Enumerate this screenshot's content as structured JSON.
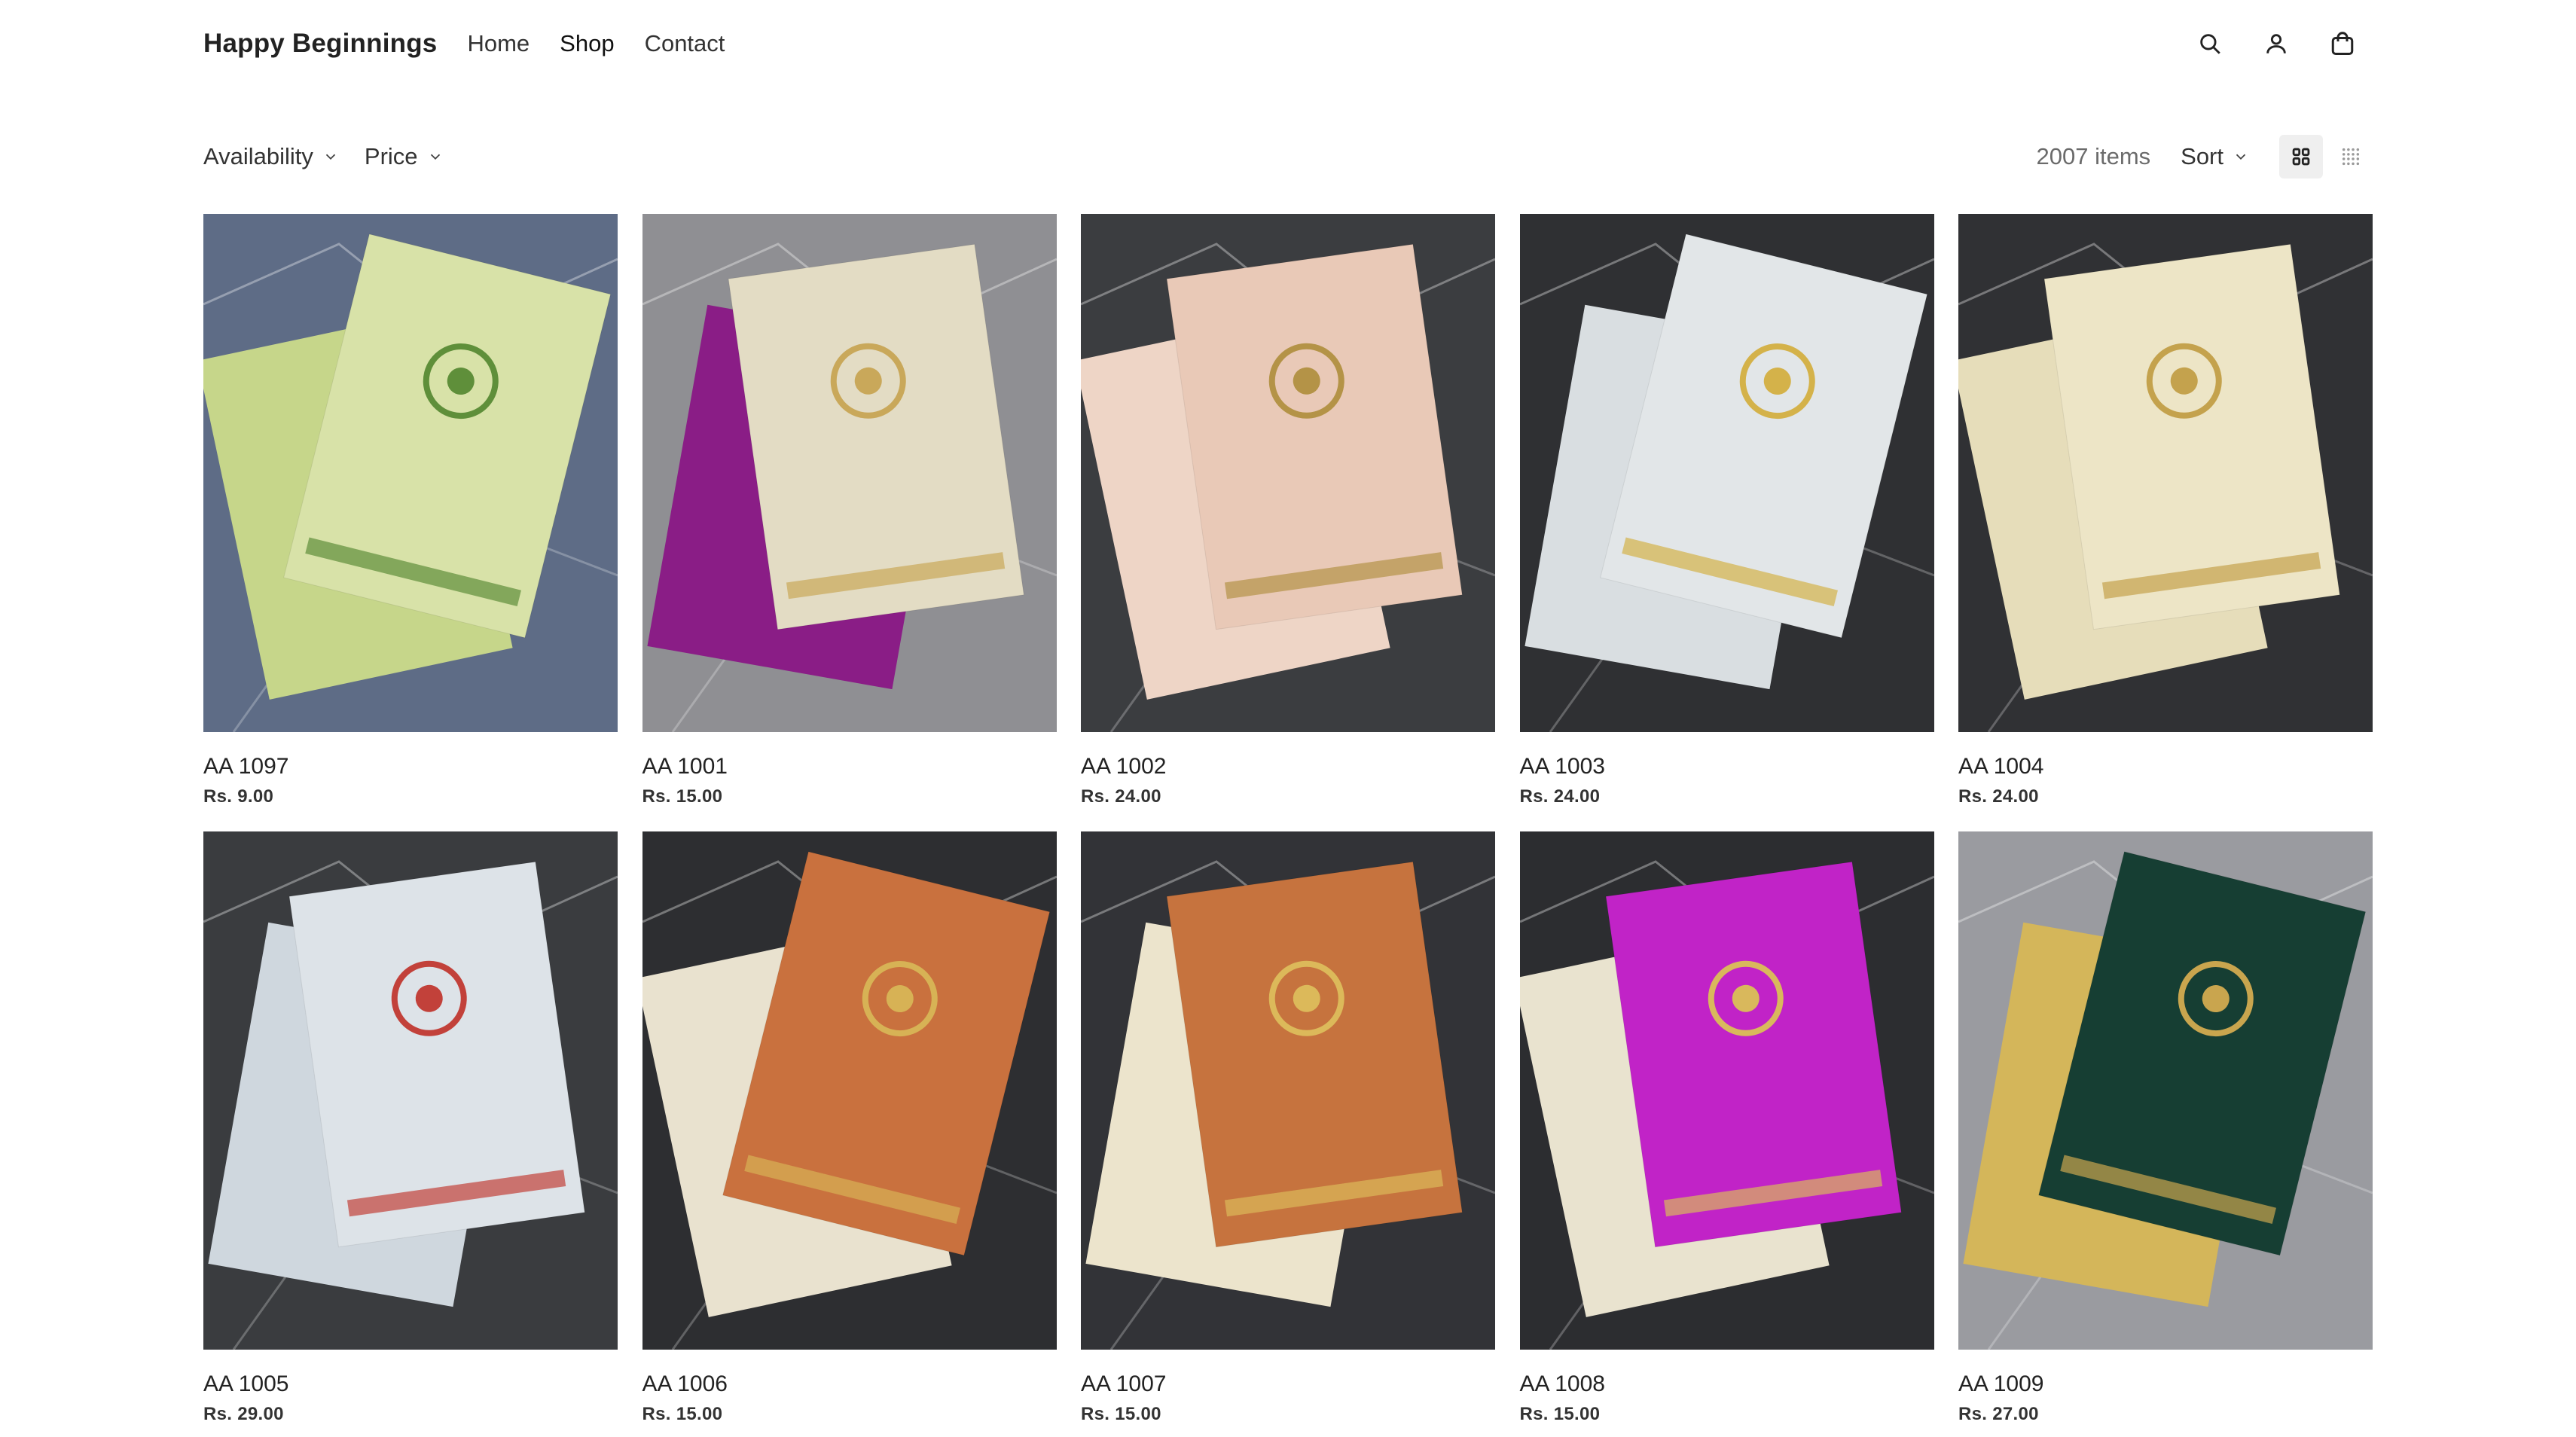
{
  "header": {
    "brand": "Happy Beginnings",
    "nav": [
      {
        "label": "Home"
      },
      {
        "label": "Shop"
      },
      {
        "label": "Contact"
      }
    ],
    "icons": [
      "search-icon",
      "account-icon",
      "cart-icon"
    ]
  },
  "filters": {
    "availability": "Availability",
    "price": "Price",
    "item_count": "2007 items",
    "sort": "Sort"
  },
  "products": [
    {
      "name": "AA 1097",
      "price": "Rs. 9.00",
      "bg": "#5e6c86",
      "card": "#d8e2a8",
      "env": "#c6d68a",
      "accent": "#5f8f3a"
    },
    {
      "name": "AA 1001",
      "price": "Rs. 15.00",
      "bg": "#8f8f93",
      "card": "#e3dcc4",
      "env": "#8a1d86",
      "accent": "#c9a85a"
    },
    {
      "name": "AA 1002",
      "price": "Rs. 24.00",
      "bg": "#3b3d40",
      "card": "#e9c9b7",
      "env": "#eed5c6",
      "accent": "#b49347"
    },
    {
      "name": "AA 1003",
      "price": "Rs. 24.00",
      "bg": "#2f3033",
      "card": "#e2e6e8",
      "env": "#d9dee1",
      "accent": "#d4b24a"
    },
    {
      "name": "AA 1004",
      "price": "Rs. 24.00",
      "bg": "#303134",
      "card": "#ede5c6",
      "env": "#e6ddba",
      "accent": "#c4a24d"
    },
    {
      "name": "AA 1005",
      "price": "Rs. 29.00",
      "bg": "#3a3c3f",
      "card": "#dde3e8",
      "env": "#cfd7de",
      "accent": "#c2413a"
    },
    {
      "name": "AA 1006",
      "price": "Rs. 15.00",
      "bg": "#2d2e31",
      "card": "#c9713e",
      "env": "#e9e2cf",
      "accent": "#d7b255"
    },
    {
      "name": "AA 1007",
      "price": "Rs. 15.00",
      "bg": "#323337",
      "card": "#c6733e",
      "env": "#ece4cc",
      "accent": "#dcb95a"
    },
    {
      "name": "AA 1008",
      "price": "Rs. 15.00",
      "bg": "#2c2d30",
      "card": "#c123c7",
      "env": "#e9e3cf",
      "accent": "#d9b85c"
    },
    {
      "name": "AA 1009",
      "price": "Rs. 27.00",
      "bg": "#9a9ba0",
      "card": "#163e33",
      "env": "#d4b65a",
      "accent": "#c9a54e"
    }
  ]
}
